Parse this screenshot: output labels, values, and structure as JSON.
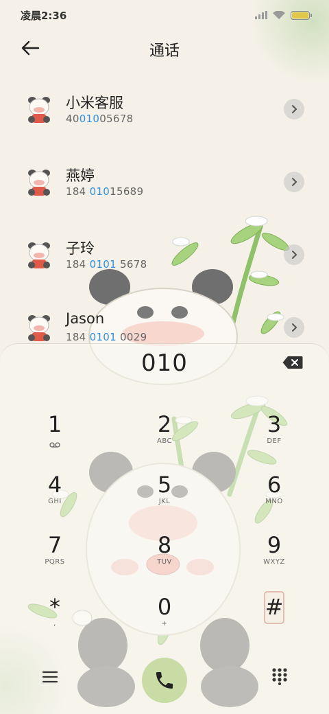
{
  "status_bar": {
    "time": "凌晨2:36"
  },
  "header": {
    "title": "通话"
  },
  "contacts": [
    {
      "name": "小米客服",
      "number_pre": "40",
      "number_hl": "010",
      "number_post": "05678"
    },
    {
      "name": "燕婷",
      "number_pre": "184 ",
      "number_hl": "010",
      "number_post": "15689"
    },
    {
      "name": "子玲",
      "number_pre": "184 ",
      "number_hl": "0101",
      "number_post": " 5678"
    },
    {
      "name": "Jason",
      "number_pre": "184 ",
      "number_hl": "0101",
      "number_post": " 0029"
    }
  ],
  "dialpad": {
    "entered": "010",
    "keys": [
      {
        "digit": "1",
        "letters": ""
      },
      {
        "digit": "2",
        "letters": "ABC"
      },
      {
        "digit": "3",
        "letters": "DEF"
      },
      {
        "digit": "4",
        "letters": "GHI"
      },
      {
        "digit": "5",
        "letters": "JKL"
      },
      {
        "digit": "6",
        "letters": "MNO"
      },
      {
        "digit": "7",
        "letters": "PQRS"
      },
      {
        "digit": "8",
        "letters": "TUV"
      },
      {
        "digit": "9",
        "letters": "WXYZ"
      },
      {
        "digit": "*",
        "letters": ","
      },
      {
        "digit": "0",
        "letters": "+"
      },
      {
        "digit": "#",
        "letters": ""
      }
    ],
    "icons": {
      "voicemail": "voicemail-icon",
      "backspace": "backspace-icon",
      "call": "phone-icon",
      "menu": "menu-icon",
      "keypad": "keypad-icon"
    }
  },
  "colors": {
    "highlight": "#2f8fe0",
    "call_button": "#c9dca6",
    "background": "#f5f1e8"
  }
}
